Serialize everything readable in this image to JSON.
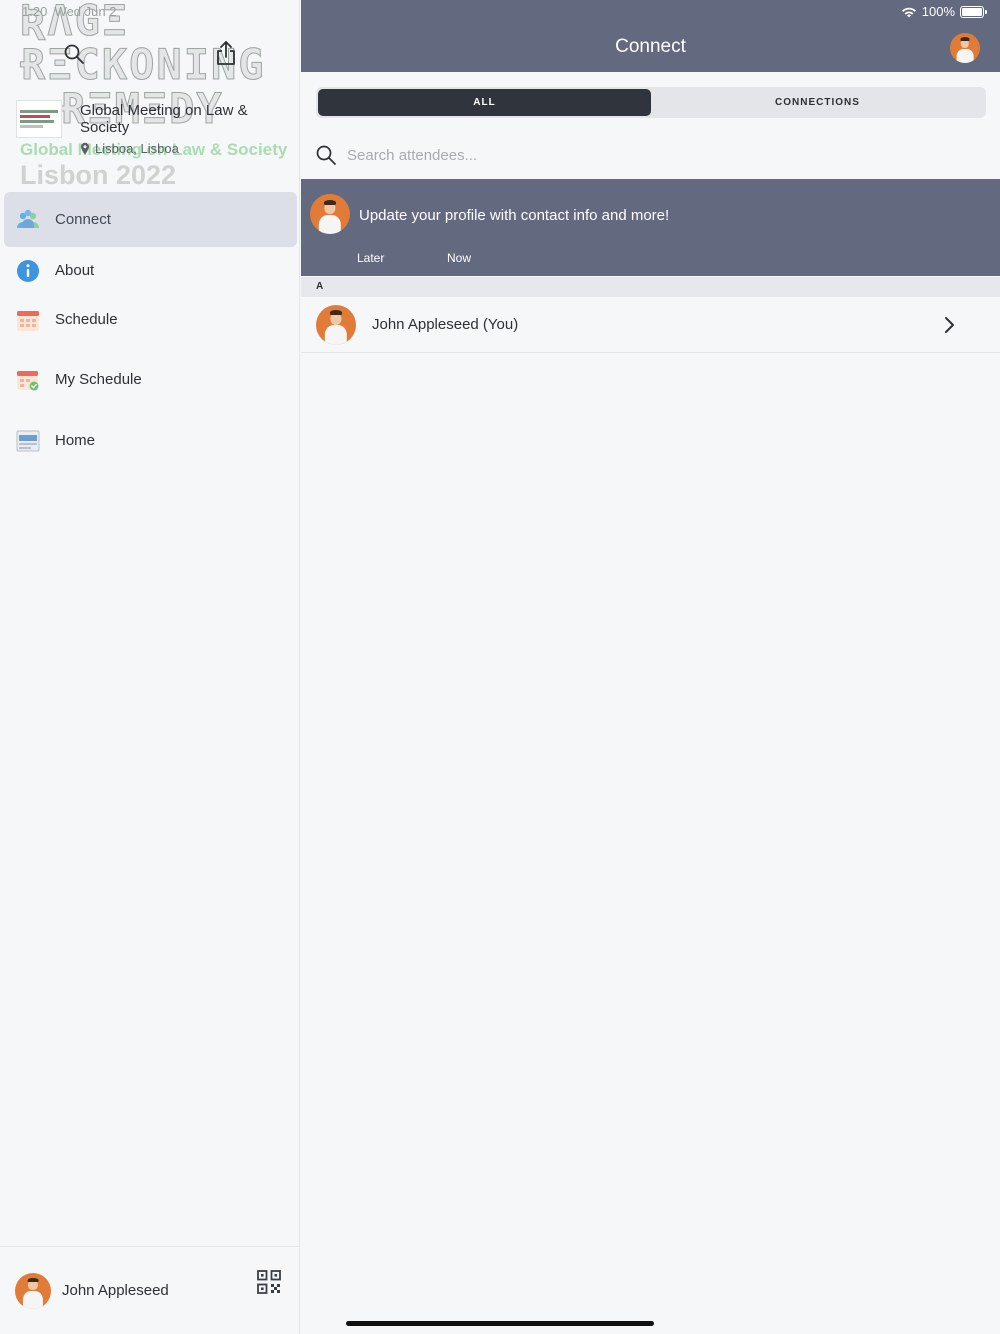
{
  "status_bar": {
    "time": "1:20",
    "date": "Wed Jun 2",
    "battery": "100%",
    "battery_level": 1.0
  },
  "sidebar": {
    "banner_green_text": "Global Meeting on Law & Society",
    "banner_lisbon_text": "Lisbon 2022",
    "event_title": "Global Meeting on Law & Society",
    "event_location": "Lisboa, Lisboa",
    "items": [
      {
        "label": "Connect",
        "icon": "people-icon",
        "active": true
      },
      {
        "label": "About",
        "icon": "info-icon",
        "active": false
      },
      {
        "label": "Schedule",
        "icon": "calendar-icon",
        "active": false
      },
      {
        "label": "My Schedule",
        "icon": "calendar-check-icon",
        "active": false
      },
      {
        "label": "Home",
        "icon": "home-page-icon",
        "active": false
      }
    ],
    "footer": {
      "user_name": "John Appleseed"
    }
  },
  "header": {
    "title": "Connect"
  },
  "segmented": {
    "options": [
      "ALL",
      "CONNECTIONS"
    ],
    "selected": "ALL"
  },
  "search": {
    "placeholder": "Search attendees...",
    "value": ""
  },
  "profile_prompt": {
    "message": "Update your profile with contact info and more!",
    "later_label": "Later",
    "now_label": "Now"
  },
  "attendees": {
    "sections": [
      {
        "letter": "A",
        "rows": [
          {
            "name": "John Appleseed (You)"
          }
        ]
      }
    ]
  },
  "colors": {
    "nav_bar": "#636a7f",
    "active_nav_bg": "#dcdfe8",
    "segment_active": "#30353d",
    "avatar_bg": "#e07c38"
  }
}
